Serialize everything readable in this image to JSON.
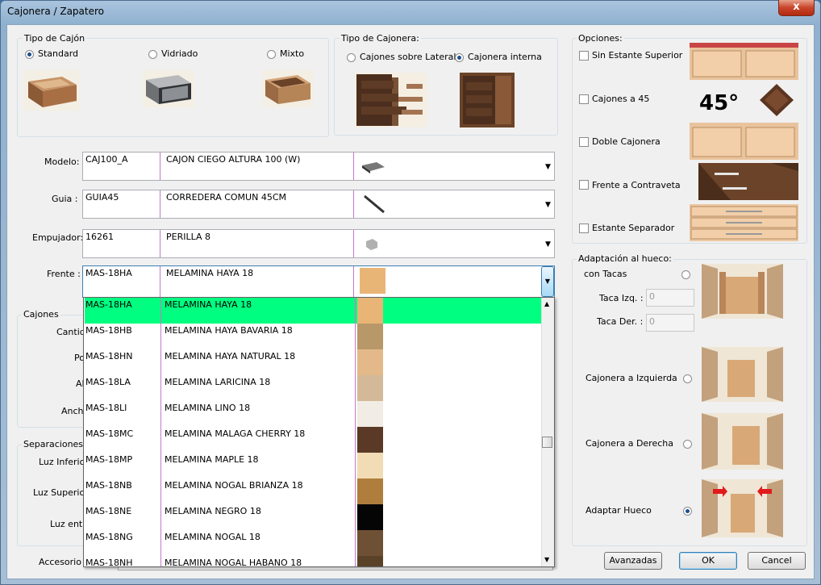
{
  "window": {
    "title": "Cajonera / Zapatero",
    "close_glyph": "x"
  },
  "tipo_cajon": {
    "title": "Tipo de Cajón",
    "options": [
      {
        "label": "Standard",
        "selected": true
      },
      {
        "label": "Vidriado",
        "selected": false
      },
      {
        "label": "Mixto",
        "selected": false
      }
    ]
  },
  "tipo_cajonera": {
    "title": "Tipo de Cajonera:",
    "options": [
      {
        "label": "Cajones sobre Lateral",
        "selected": false
      },
      {
        "label": "Cajonera interna",
        "selected": true
      }
    ]
  },
  "opciones": {
    "title": "Opciones:",
    "items": [
      {
        "label": "Sin Estante Superior",
        "checked": false
      },
      {
        "label": "Cajones a 45",
        "checked": false
      },
      {
        "label": "Doble Cajonera",
        "checked": false
      },
      {
        "label": "Frente a Contraveta",
        "checked": false
      },
      {
        "label": "Estante Separador",
        "checked": false
      }
    ],
    "angle_label": "45°"
  },
  "form": {
    "modelo": {
      "label": "Modelo:",
      "code": "CAJ100_A",
      "desc": "CAJON CIEGO ALTURA 100 (W)"
    },
    "guia": {
      "label": "Guia :",
      "code": "GUIA45",
      "desc": "CORREDERA COMUN 45CM"
    },
    "empujador": {
      "label": "Empujador:",
      "code": "16261",
      "desc": "PERILLA 8"
    },
    "frente": {
      "label": "Frente :",
      "code": "MAS-18HA",
      "desc": "MELAMINA HAYA 18"
    }
  },
  "cajones": {
    "title": "Cajones",
    "labels": [
      "Cantid",
      "Po",
      "Al",
      "Anch"
    ]
  },
  "separaciones": {
    "title": "Separaciones",
    "labels": [
      "Luz Inferior",
      "Luz Superior",
      "Luz entre"
    ]
  },
  "accesorio_label": "Accesorio :",
  "dropdown": {
    "items": [
      {
        "code": "MAS-18HA",
        "desc": "MELAMINA HAYA 18",
        "color": "#e8b577"
      },
      {
        "code": "MAS-18HB",
        "desc": "MELAMINA HAYA BAVARIA 18",
        "color": "#b89868"
      },
      {
        "code": "MAS-18HN",
        "desc": "MELAMINA HAYA NATURAL 18",
        "color": "#e3b98a"
      },
      {
        "code": "MAS-18LA",
        "desc": "MELAMINA LARICINA 18",
        "color": "#d3b998"
      },
      {
        "code": "MAS-18LI",
        "desc": "MELAMINA LINO 18",
        "color": "#f1ede4"
      },
      {
        "code": "MAS-18MC",
        "desc": "MELAMINA MALAGA CHERRY 18",
        "color": "#5a3a26"
      },
      {
        "code": "MAS-18MP",
        "desc": "MELAMINA MAPLE 18",
        "color": "#f1dcb5"
      },
      {
        "code": "MAS-18NB",
        "desc": "MELAMINA NOGAL BRIANZA 18",
        "color": "#b07e3c"
      },
      {
        "code": "MAS-18NE",
        "desc": "MELAMINA NEGRO 18",
        "color": "#050505"
      },
      {
        "code": "MAS-18NG",
        "desc": "MELAMINA NOGAL 18",
        "color": "#6e5134"
      },
      {
        "code": "MAS-18NH",
        "desc": "MELAMINA NOGAL HABANO 18",
        "color": "#5a4228"
      }
    ],
    "selected_color": "#00ff80"
  },
  "adaptacion": {
    "title": "Adaptación al hueco:",
    "con_tacas": "con Tacas",
    "taca_izq": {
      "label": "Taca Izq. :",
      "value": "0"
    },
    "taca_der": {
      "label": "Taca Der. :",
      "value": "0"
    },
    "options": [
      {
        "label": "Cajonera a Izquierda",
        "selected": false
      },
      {
        "label": "Cajonera a Derecha",
        "selected": false
      },
      {
        "label": "Adaptar Hueco",
        "selected": true
      }
    ]
  },
  "buttons": {
    "avanzadas": "Avanzadas",
    "ok": "OK",
    "cancel": "Cancel"
  },
  "colors": {
    "wood_light": "#e8c49a",
    "wood_dark": "#5a3a26",
    "wall": "#efe6d6"
  }
}
